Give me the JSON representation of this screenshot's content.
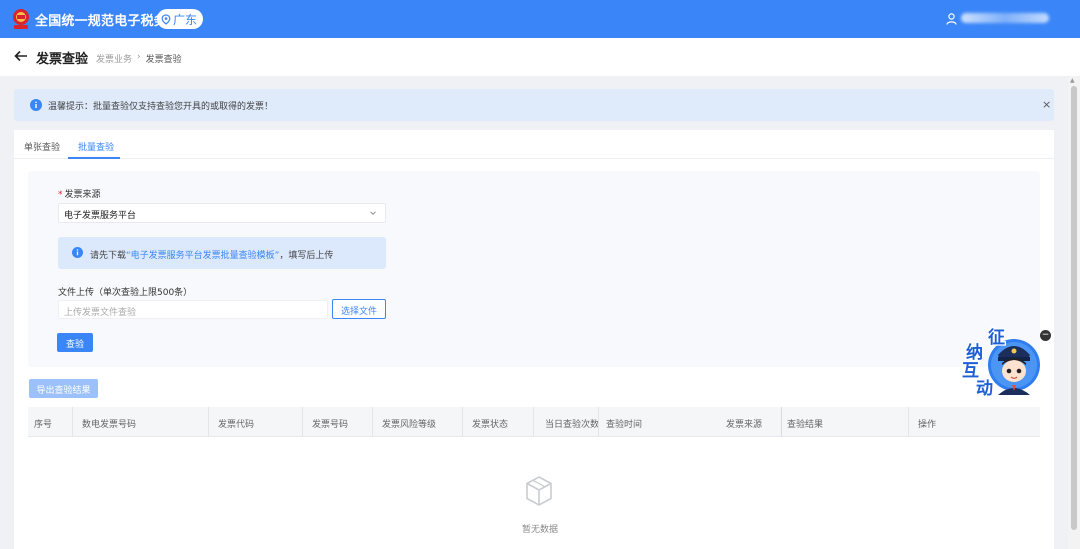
{
  "header": {
    "app_title": "全国统一规范电子税务局",
    "region": "广东",
    "logo_icon": "tax-emblem-icon",
    "user_icon": "user-icon"
  },
  "page": {
    "title": "发票查验",
    "breadcrumb": [
      "发票业务",
      "发票查验"
    ]
  },
  "notice": {
    "text": "温馨提示：批量查验仅支持查验您开具的或取得的发票！",
    "close": "×"
  },
  "tabs": [
    {
      "label": "单张查验",
      "active": false
    },
    {
      "label": "批量查验",
      "active": true
    }
  ],
  "form": {
    "source_label": "发票来源",
    "source_value": "电子发票服务平台",
    "tip_prefix": "请先下载",
    "tip_link": "“电子发票服务平台发票批量查验模板”",
    "tip_suffix": "，填写后上传",
    "upload_label": "文件上传（单次查验上限500条）",
    "upload_placeholder": "上传发票文件查验",
    "choose_button": "选择文件",
    "verify_button": "查验"
  },
  "export_button": "导出查验结果",
  "table": {
    "columns": [
      "序号",
      "数电发票号码",
      "发票代码",
      "发票号码",
      "发票风险等级",
      "发票状态",
      "当日查验次数",
      "查验时间",
      "发票来源",
      "查验结果",
      "操作"
    ],
    "empty_text": "暂无数据"
  },
  "mascot": {
    "chars": [
      "征",
      "纳",
      "互",
      "动"
    ],
    "close": "−"
  },
  "colors": {
    "primary": "#3a86f8",
    "notice_bg": "#dfeafb"
  }
}
